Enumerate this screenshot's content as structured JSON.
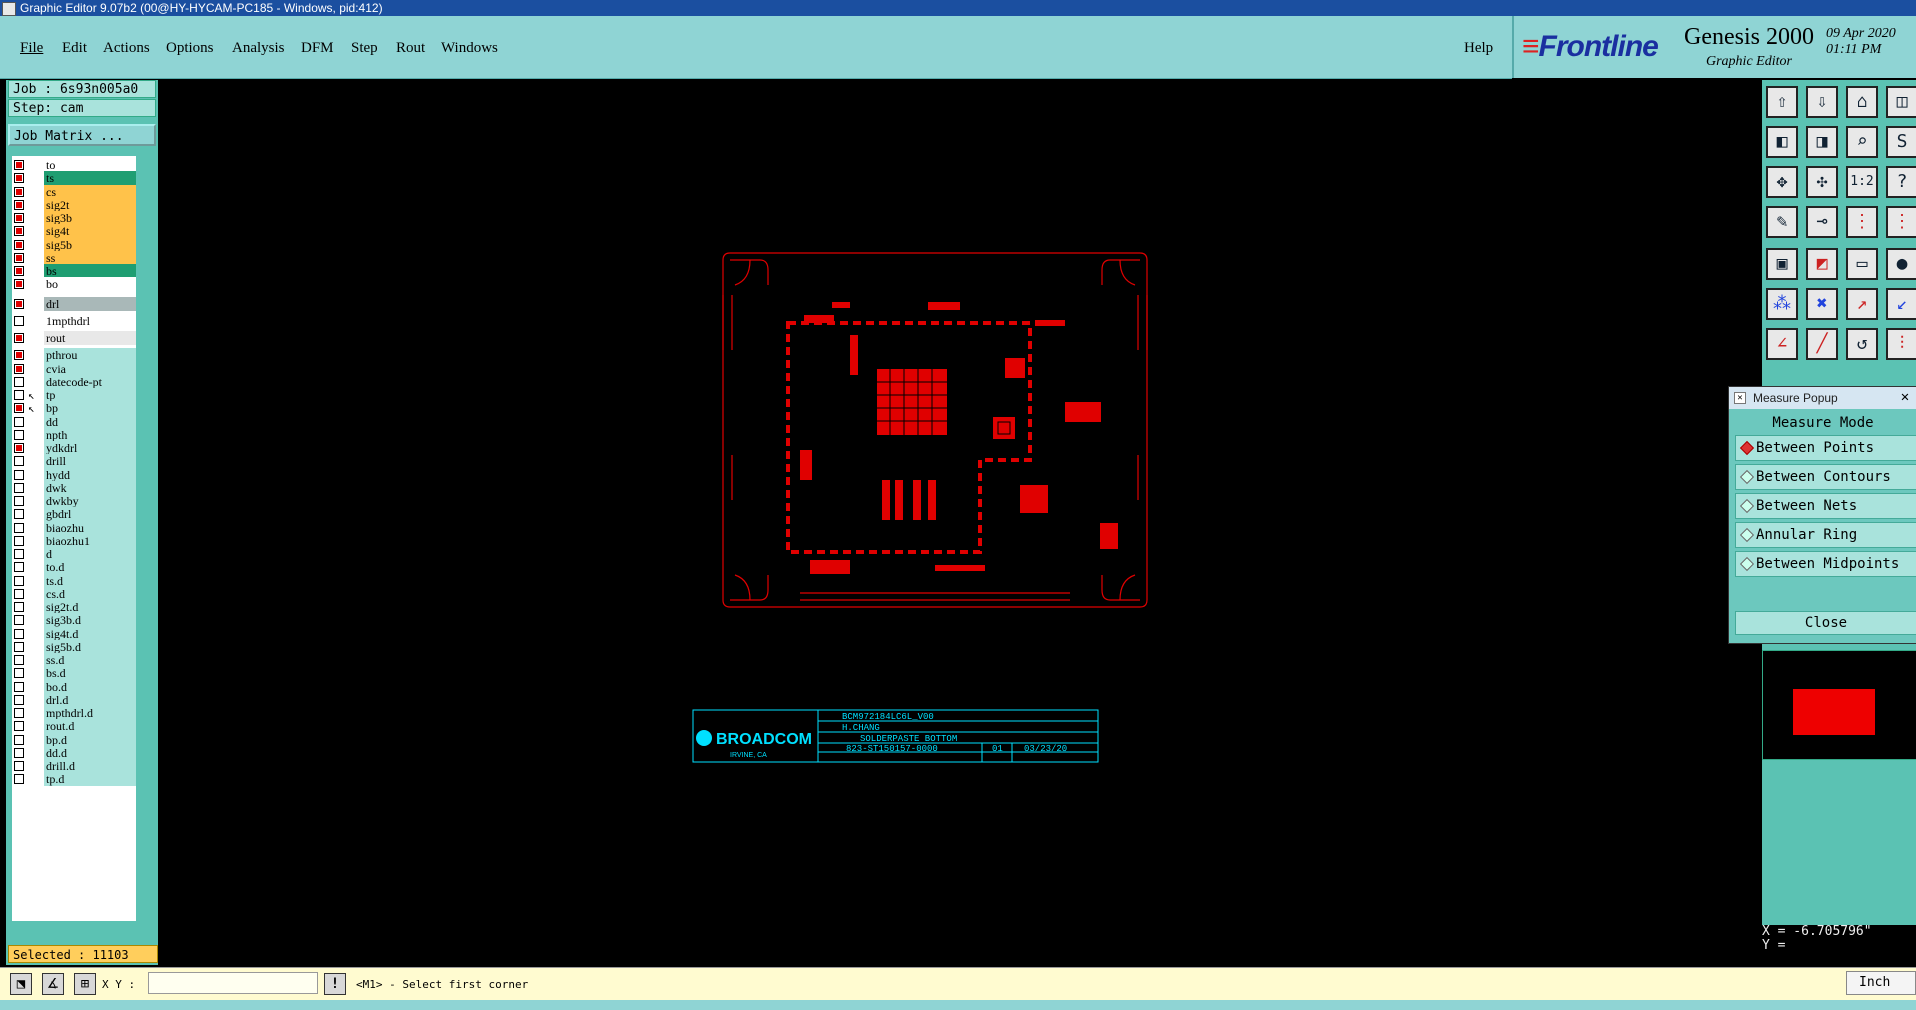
{
  "window": {
    "title": "Graphic Editor 9.07b2 (00@HY-HYCAM-PC185 - Windows, pid:412)"
  },
  "menu": {
    "items": [
      "File",
      "Edit",
      "Actions",
      "Options",
      "Analysis",
      "DFM",
      "Step",
      "Rout",
      "Windows"
    ],
    "help": "Help"
  },
  "brand": {
    "logo": "Frontline",
    "product": "Genesis 2000",
    "subtitle": "Graphic Editor",
    "date": "09 Apr 2020",
    "time": "01:11 PM"
  },
  "job": {
    "job_line": "Job : 6s93n005a0",
    "step_line": "Step: cam",
    "matrix_button": "Job Matrix ..."
  },
  "layers": [
    {
      "name": "to",
      "color": "#ffffff",
      "on": true,
      "mark": ""
    },
    {
      "name": "ts",
      "color": "#1f9e72",
      "on": true,
      "mark": ""
    },
    {
      "name": "cs",
      "color": "#ffc24a",
      "on": true,
      "mark": ""
    },
    {
      "name": "sig2t",
      "color": "#ffc24a",
      "on": true,
      "mark": ""
    },
    {
      "name": "sig3b",
      "color": "#ffc24a",
      "on": true,
      "mark": ""
    },
    {
      "name": "sig4t",
      "color": "#ffc24a",
      "on": true,
      "mark": ""
    },
    {
      "name": "sig5b",
      "color": "#ffc24a",
      "on": true,
      "mark": ""
    },
    {
      "name": "ss",
      "color": "#ffc24a",
      "on": true,
      "mark": ""
    },
    {
      "name": "bs",
      "color": "#1f9e72",
      "on": true,
      "mark": ""
    },
    {
      "name": "bo",
      "color": "#ffffff",
      "on": true,
      "mark": ""
    },
    {
      "name": "drl",
      "color": "#a9b8b8",
      "on": true,
      "mark": ""
    },
    {
      "name": "1mpthdrl",
      "color": "#ffffff",
      "on": false,
      "mark": ""
    },
    {
      "name": "rout",
      "color": "#e8e8e8",
      "on": true,
      "mark": ""
    },
    {
      "name": "pthrou",
      "color": "#a9e3dc",
      "on": true,
      "mark": ""
    },
    {
      "name": "cvia",
      "color": "#a9e3dc",
      "on": true,
      "mark": ""
    },
    {
      "name": "datecode-pt",
      "color": "#a9e3dc",
      "on": false,
      "mark": ""
    },
    {
      "name": "tp",
      "color": "#a9e3dc",
      "on": false,
      "mark": "↖"
    },
    {
      "name": "bp",
      "color": "#a9e3dc",
      "on": true,
      "mark": "↖"
    },
    {
      "name": "dd",
      "color": "#a9e3dc",
      "on": false,
      "mark": ""
    },
    {
      "name": "npth",
      "color": "#a9e3dc",
      "on": false,
      "mark": ""
    },
    {
      "name": "ydkdrl",
      "color": "#a9e3dc",
      "on": true,
      "mark": ""
    },
    {
      "name": "drill",
      "color": "#a9e3dc",
      "on": false,
      "mark": ""
    },
    {
      "name": "hydd",
      "color": "#a9e3dc",
      "on": false,
      "mark": ""
    },
    {
      "name": "dwk",
      "color": "#a9e3dc",
      "on": false,
      "mark": ""
    },
    {
      "name": "dwkby",
      "color": "#a9e3dc",
      "on": false,
      "mark": ""
    },
    {
      "name": "gbdrl",
      "color": "#a9e3dc",
      "on": false,
      "mark": ""
    },
    {
      "name": "biaozhu",
      "color": "#a9e3dc",
      "on": false,
      "mark": ""
    },
    {
      "name": "biaozhu1",
      "color": "#a9e3dc",
      "on": false,
      "mark": ""
    },
    {
      "name": "d",
      "color": "#a9e3dc",
      "on": false,
      "mark": ""
    },
    {
      "name": "to.d",
      "color": "#a9e3dc",
      "on": false,
      "mark": ""
    },
    {
      "name": "ts.d",
      "color": "#a9e3dc",
      "on": false,
      "mark": ""
    },
    {
      "name": "cs.d",
      "color": "#a9e3dc",
      "on": false,
      "mark": ""
    },
    {
      "name": "sig2t.d",
      "color": "#a9e3dc",
      "on": false,
      "mark": ""
    },
    {
      "name": "sig3b.d",
      "color": "#a9e3dc",
      "on": false,
      "mark": ""
    },
    {
      "name": "sig4t.d",
      "color": "#a9e3dc",
      "on": false,
      "mark": ""
    },
    {
      "name": "sig5b.d",
      "color": "#a9e3dc",
      "on": false,
      "mark": ""
    },
    {
      "name": "ss.d",
      "color": "#a9e3dc",
      "on": false,
      "mark": ""
    },
    {
      "name": "bs.d",
      "color": "#a9e3dc",
      "on": false,
      "mark": ""
    },
    {
      "name": "bo.d",
      "color": "#a9e3dc",
      "on": false,
      "mark": ""
    },
    {
      "name": "drl.d",
      "color": "#a9e3dc",
      "on": false,
      "mark": ""
    },
    {
      "name": "mpthdrl.d",
      "color": "#a9e3dc",
      "on": false,
      "mark": ""
    },
    {
      "name": "rout.d",
      "color": "#a9e3dc",
      "on": false,
      "mark": ""
    },
    {
      "name": "bp.d",
      "color": "#a9e3dc",
      "on": false,
      "mark": ""
    },
    {
      "name": "dd.d",
      "color": "#a9e3dc",
      "on": false,
      "mark": ""
    },
    {
      "name": "drill.d",
      "color": "#a9e3dc",
      "on": false,
      "mark": ""
    },
    {
      "name": "tp.d",
      "color": "#a9e3dc",
      "on": false,
      "mark": ""
    }
  ],
  "selected": "Selected : 11103",
  "measure_popup": {
    "title": "Measure Popup",
    "heading": "Measure Mode",
    "options": [
      {
        "label": "Between Points",
        "selected": true
      },
      {
        "label": "Between Contours",
        "selected": false
      },
      {
        "label": "Between Nets",
        "selected": false
      },
      {
        "label": "Annular Ring",
        "selected": false
      },
      {
        "label": "Between Midpoints",
        "selected": false
      }
    ],
    "close_label": "Close"
  },
  "coordinates": {
    "x_line": "X = -6.705796\"",
    "y_line": "Y = "
  },
  "bottombar": {
    "xy_label": "X Y :",
    "xy_value": "",
    "status": "<M1> - Select first corner",
    "units": "Inch"
  },
  "title_block": {
    "company": "BROADCOM",
    "location": "IRVINE, CA",
    "project": "BCM972184LC6L_V00",
    "drawn_by": "H.CHANG",
    "title": "SOLDERPASTE BOTTOM",
    "part_number": "823-ST150157-0000",
    "rev": "01",
    "date": "03/23/20"
  },
  "colors": {
    "accent": "#8fd4d4",
    "panel": "#5bc2b3",
    "board": "#e00000",
    "titleblock": "#00e0ff"
  }
}
